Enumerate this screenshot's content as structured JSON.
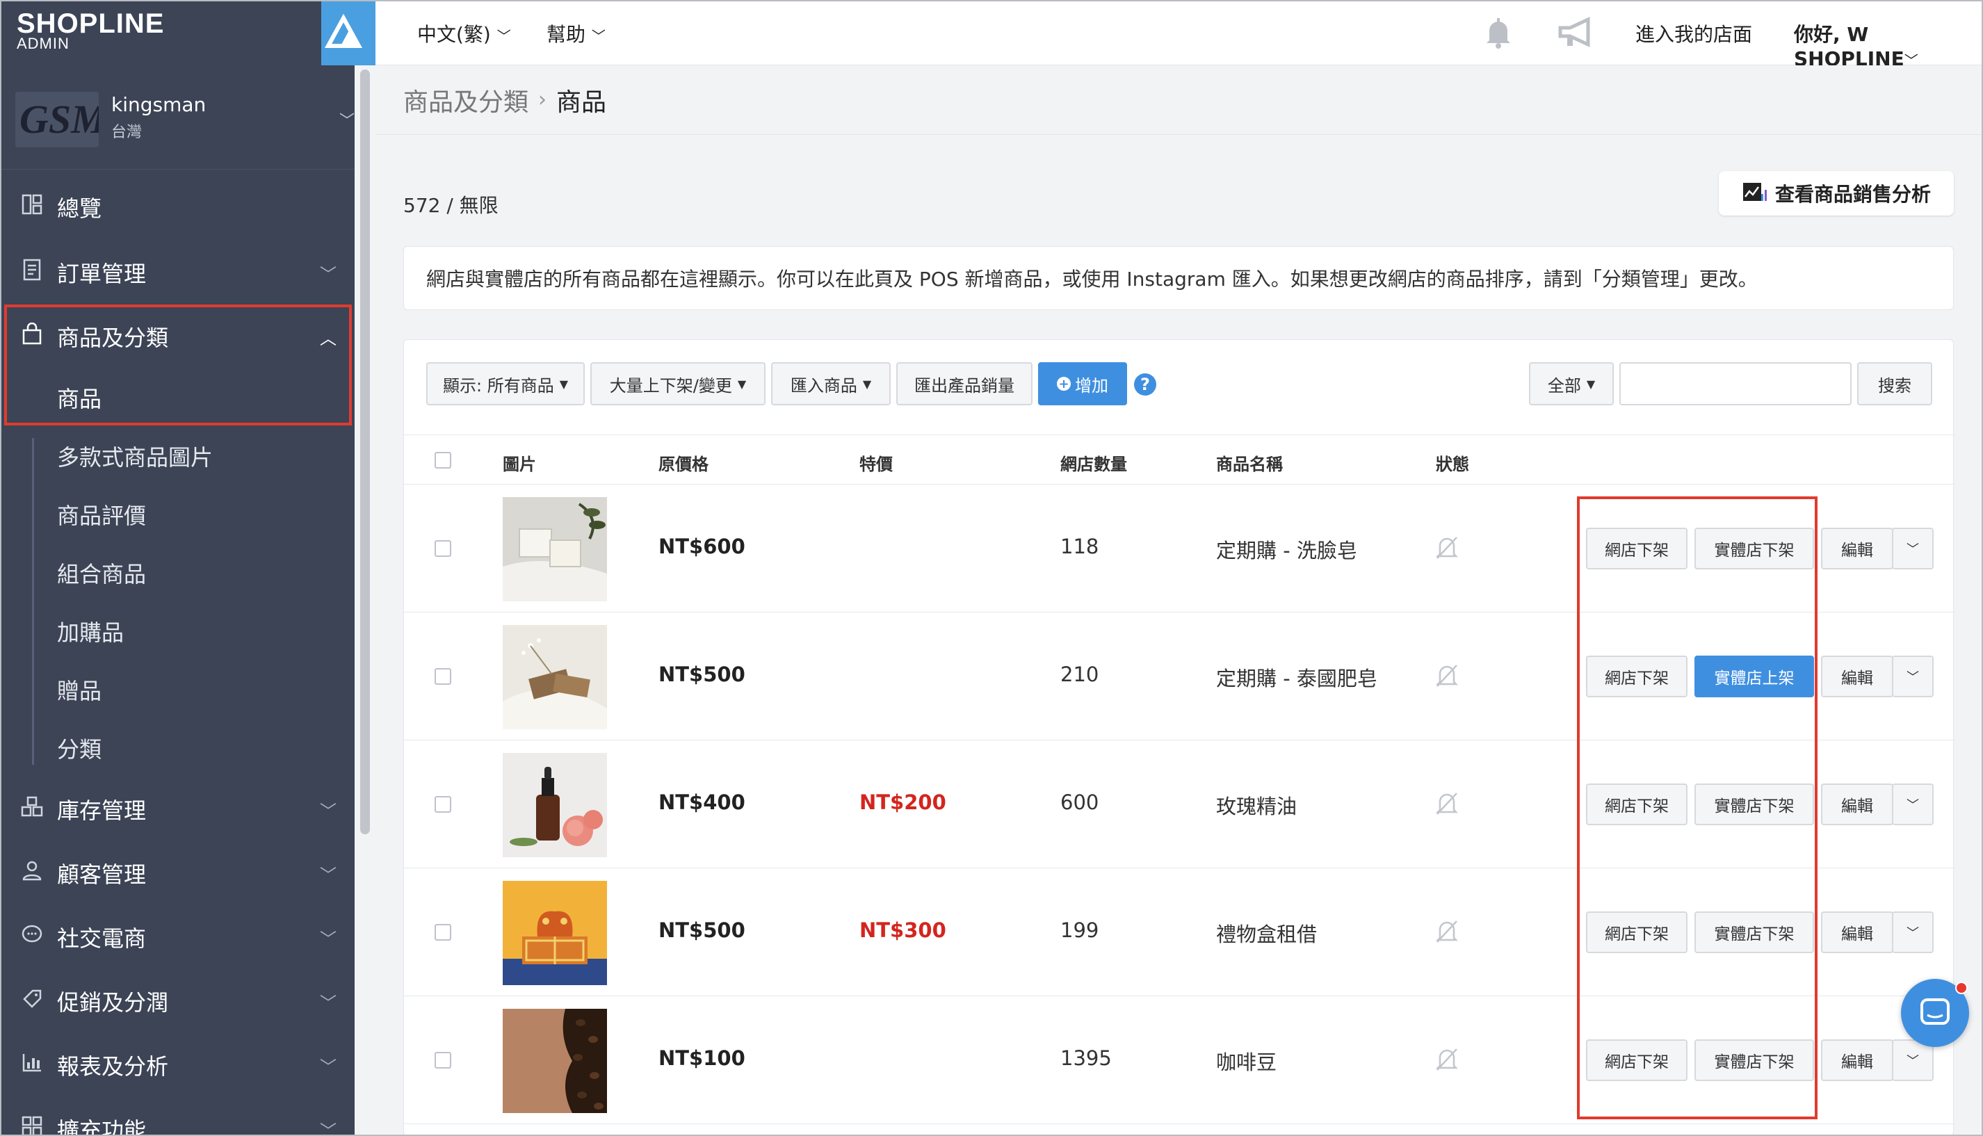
{
  "brand": {
    "logo": "SHOPLINE",
    "sub": "ADMIN"
  },
  "store": {
    "logo_text": "GSM",
    "name": "kingsman",
    "region": "台灣"
  },
  "sidebar": {
    "items": [
      {
        "label": "總覽",
        "icon": "dashboard-icon"
      },
      {
        "label": "訂單管理",
        "icon": "order-icon"
      },
      {
        "label": "商品及分類",
        "icon": "bag-icon"
      },
      {
        "label": "庫存管理",
        "icon": "inventory-icon"
      },
      {
        "label": "顧客管理",
        "icon": "user-icon"
      },
      {
        "label": "社交電商",
        "icon": "chat-icon"
      },
      {
        "label": "促銷及分潤",
        "icon": "tag-icon"
      },
      {
        "label": "報表及分析",
        "icon": "report-icon"
      },
      {
        "label": "擴充功能",
        "icon": "apps-icon"
      }
    ],
    "subitems": [
      "商品",
      "多款式商品圖片",
      "商品評價",
      "組合商品",
      "加購品",
      "贈品",
      "分類"
    ]
  },
  "topbar": {
    "language": "中文(繁)",
    "help": "幫助",
    "visit_store": "進入我的店面",
    "greeting": "你好, W SHOPLINE"
  },
  "breadcrumb": {
    "parent": "商品及分類",
    "current": "商品"
  },
  "count_text": "572 / 無限",
  "analysis_button": "查看商品銷售分析",
  "notice": "網店與實體店的所有商品都在這裡顯示。你可以在此頁及 POS 新增商品，或使用 Instagram 匯入。如果想更改網店的商品排序，請到「分類管理」更改。",
  "toolbar": {
    "display": "顯示: 所有商品",
    "bulk": "大量上下架/變更",
    "import": "匯入商品",
    "export": "匯出產品銷量",
    "add": "增加",
    "scope": "全部",
    "search_value": "",
    "search": "搜索"
  },
  "table": {
    "headers": {
      "image": "圖片",
      "price": "原價格",
      "sale": "特價",
      "qty": "網店數量",
      "name": "商品名稱",
      "status": "狀態"
    },
    "rows": [
      {
        "price": "NT$600",
        "sale": "",
        "qty": "118",
        "name": "定期購 - 洗臉皂",
        "online_btn": "網店下架",
        "pos_btn": "實體店下架",
        "pos_active": false,
        "edit": "編輯",
        "thumb": "soap-bars"
      },
      {
        "price": "NT$500",
        "sale": "",
        "qty": "210",
        "name": "定期購 - 泰國肥皂",
        "online_btn": "網店下架",
        "pos_btn": "實體店上架",
        "pos_active": true,
        "edit": "編輯",
        "thumb": "thai-soap"
      },
      {
        "price": "NT$400",
        "sale": "NT$200",
        "qty": "600",
        "name": "玫瑰精油",
        "online_btn": "網店下架",
        "pos_btn": "實體店下架",
        "pos_active": false,
        "edit": "編輯",
        "thumb": "rose-oil"
      },
      {
        "price": "NT$500",
        "sale": "NT$300",
        "qty": "199",
        "name": "禮物盒租借",
        "online_btn": "網店下架",
        "pos_btn": "實體店下架",
        "pos_active": false,
        "edit": "編輯",
        "thumb": "gift-box"
      },
      {
        "price": "NT$100",
        "sale": "",
        "qty": "1395",
        "name": "咖啡豆",
        "online_btn": "網店下架",
        "pos_btn": "實體店下架",
        "pos_active": false,
        "edit": "編輯",
        "thumb": "coffee-beans"
      }
    ]
  },
  "colors": {
    "sidebar_bg": "#3c4456",
    "accent": "#3f8fe0",
    "highlight": "#e03b2f",
    "sale": "#d3251e"
  }
}
